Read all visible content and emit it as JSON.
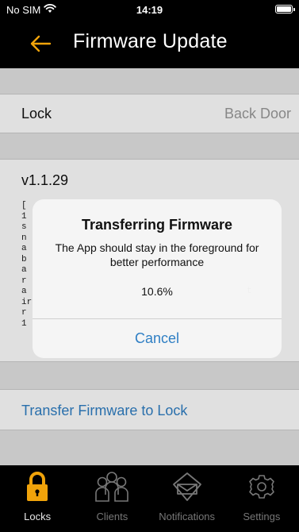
{
  "status_bar": {
    "carrier": "No SIM",
    "time": "14:19"
  },
  "nav": {
    "title": "Firmware Update"
  },
  "lock_row": {
    "key": "Lock",
    "value": "Back Door"
  },
  "firmware": {
    "version": "v1.1.29",
    "notes_visible": "[\n1\ns\nn\na\nb\na\nr\na                                          t\nir\nr\n1"
  },
  "transfer_button": "Transfer Firmware to Lock",
  "alert": {
    "title": "Transferring Firmware",
    "message": "The App should stay in the foreground for better performance",
    "progress": "10.6%",
    "cancel": "Cancel"
  },
  "tabs": [
    {
      "label": "Locks",
      "icon": "lock-icon",
      "active": true
    },
    {
      "label": "Clients",
      "icon": "clients-icon",
      "active": false
    },
    {
      "label": "Notifications",
      "icon": "notifications-icon",
      "active": false
    },
    {
      "label": "Settings",
      "icon": "settings-icon",
      "active": false
    }
  ],
  "colors": {
    "accent": "#f0a30a",
    "link": "#2f7fc4",
    "background": "#e4e4e4"
  }
}
